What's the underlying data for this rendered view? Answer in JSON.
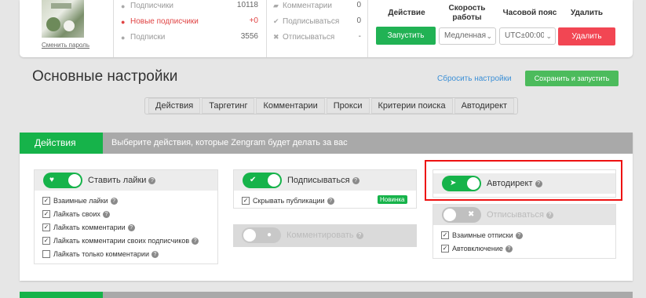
{
  "profile": {
    "change_password": "Сменить пароль"
  },
  "stats": [
    {
      "icon": "users-icon",
      "glyph": "👥",
      "label": "Подписчики",
      "value": "10118",
      "red": false
    },
    {
      "icon": "user-plus-icon",
      "glyph": "👤",
      "label": "Новые подписчики",
      "value": "+0",
      "red": true
    },
    {
      "icon": "user-icon",
      "glyph": "👥",
      "label": "Подписки",
      "value": "3556",
      "red": false
    }
  ],
  "activity": [
    {
      "icon": "comment-icon",
      "glyph": "💬",
      "label": "Комментарии",
      "value": "0"
    },
    {
      "icon": "check-icon",
      "glyph": "✔",
      "label": "Подписываться",
      "value": "0"
    },
    {
      "icon": "x-icon",
      "glyph": "✖",
      "label": "Отписываться",
      "value": "-"
    }
  ],
  "controls": {
    "action_head": "Действие",
    "speed_head_1": "Скорость",
    "speed_head_2": "работы",
    "tz_head": "Часовой пояс",
    "delete_head": "Удалить",
    "start_btn": "Запустить",
    "speed_value": "Медленная",
    "tz_value": "UTC±00:00",
    "delete_btn": "Удалить"
  },
  "page": {
    "title": "Основные настройки",
    "reset": "Сбросить настройки",
    "save_run": "Сохранить и запустить"
  },
  "tabs": [
    "Действия",
    "Таргетинг",
    "Комментарии",
    "Прокси",
    "Критерии поиска",
    "Автодирект"
  ],
  "section": {
    "tab": "Действия",
    "desc": "Выберите действия, которые Zengram будет делать за вас"
  },
  "likes": {
    "title": "Ставить лайки",
    "options": [
      {
        "label": "Взаимные лайки",
        "checked": true
      },
      {
        "label": "Лайкать своих",
        "checked": true
      },
      {
        "label": "Лайкать комментарии",
        "checked": true
      },
      {
        "label": "Лайкать комментарии своих подписчиков",
        "checked": true
      },
      {
        "label": "Лайкать только комментарии",
        "checked": false
      }
    ]
  },
  "follow": {
    "title": "Подписываться",
    "option": "Скрывать публикации",
    "badge": "Новинка"
  },
  "comment": {
    "title": "Комментировать"
  },
  "direct": {
    "title": "Автодирект"
  },
  "unfollow": {
    "title": "Отписываться",
    "options": [
      {
        "label": "Взаимные отписки",
        "checked": true
      },
      {
        "label": "Автовключение",
        "checked": true
      }
    ]
  },
  "colors": {
    "green": "#16b34a",
    "red": "#f24653",
    "link": "#3b8fd6",
    "highlight": "#e11111"
  }
}
